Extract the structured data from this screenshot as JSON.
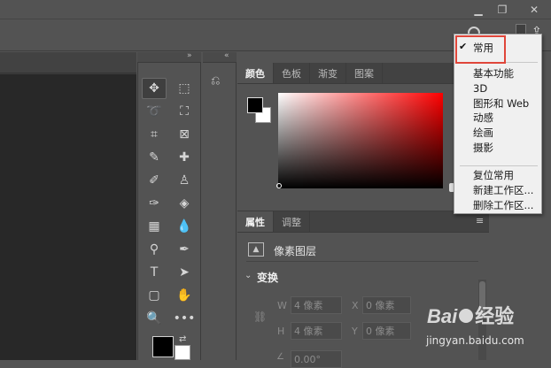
{
  "window": {
    "minimize_icon": "minimize-icon",
    "restore_icon": "restore-icon",
    "close_icon": "close-icon"
  },
  "tools": [
    {
      "name": "move-tool-icon",
      "glyph": "✥"
    },
    {
      "name": "marquee-tool-icon",
      "glyph": "⬚"
    },
    {
      "name": "lasso-tool-icon",
      "glyph": "➰"
    },
    {
      "name": "object-select-tool-icon",
      "glyph": "⛶"
    },
    {
      "name": "crop-tool-icon",
      "glyph": "⌗"
    },
    {
      "name": "frame-tool-icon",
      "glyph": "⊠"
    },
    {
      "name": "eyedropper-tool-icon",
      "glyph": "✎"
    },
    {
      "name": "healing-brush-tool-icon",
      "glyph": "✚"
    },
    {
      "name": "brush-tool-icon",
      "glyph": "✐"
    },
    {
      "name": "stamp-tool-icon",
      "glyph": "♙"
    },
    {
      "name": "history-brush-tool-icon",
      "glyph": "✑"
    },
    {
      "name": "eraser-tool-icon",
      "glyph": "◈"
    },
    {
      "name": "gradient-tool-icon",
      "glyph": "▦"
    },
    {
      "name": "blur-tool-icon",
      "glyph": "💧"
    },
    {
      "name": "dodge-tool-icon",
      "glyph": "⚲"
    },
    {
      "name": "pen-tool-icon",
      "glyph": "✒"
    },
    {
      "name": "type-tool-icon",
      "glyph": "T"
    },
    {
      "name": "path-select-tool-icon",
      "glyph": "➤"
    },
    {
      "name": "shape-tool-icon",
      "glyph": "▢"
    },
    {
      "name": "hand-tool-icon",
      "glyph": "✋"
    },
    {
      "name": "zoom-tool-icon",
      "glyph": "🔍"
    },
    {
      "name": "more-tools-icon",
      "glyph": "•••"
    }
  ],
  "color_panel": {
    "tabs": [
      "颜色",
      "色板",
      "渐变",
      "图案"
    ],
    "active_tab": "颜色"
  },
  "properties_panel": {
    "tabs": [
      "属性",
      "调整"
    ],
    "active_tab": "属性",
    "layer_type": "像素图层",
    "section_title": "变换",
    "fields": {
      "w_label": "W",
      "w_value": "4 像素",
      "h_label": "H",
      "h_value": "4 像素",
      "x_label": "X",
      "x_value": "0 像素",
      "y_label": "Y",
      "y_value": "0 像素",
      "angle_value": "0.00°"
    }
  },
  "workspace_menu": {
    "checked_item": "常用",
    "items_group1": [
      "基本功能",
      "3D",
      "图形和 Web",
      "动感",
      "绘画",
      "摄影"
    ],
    "items_group2": [
      "复位常用",
      "新建工作区...",
      "删除工作区..."
    ]
  },
  "watermark": {
    "brand_text": "Bai",
    "brand_suffix": "经验",
    "url": "jingyan.baidu.com"
  },
  "colors": {
    "highlight_box": "#e0463a",
    "background": "#535353",
    "canvas": "#282828"
  }
}
